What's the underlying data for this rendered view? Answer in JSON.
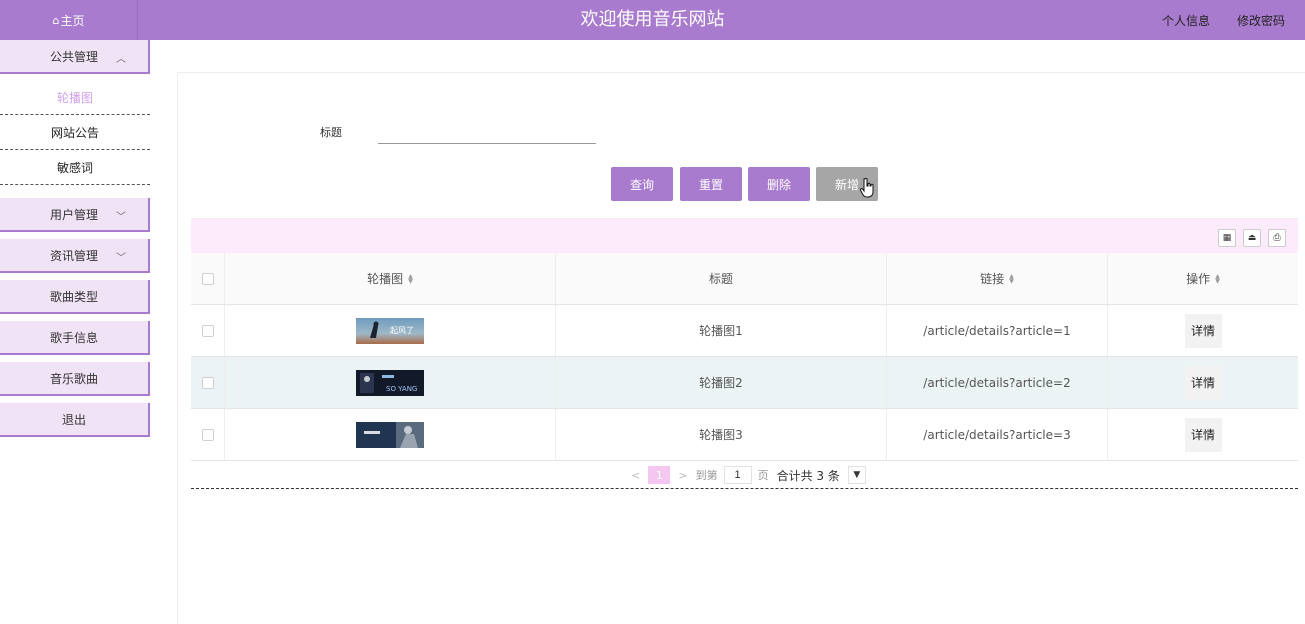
{
  "header": {
    "home_label": "主页",
    "title": "欢迎使用音乐网站",
    "links": [
      "个人信息",
      "修改密码"
    ]
  },
  "sidebar": {
    "public": "公共管理",
    "sub_items": [
      "轮播图",
      "网站公告",
      "敏感词"
    ],
    "user": "用户管理",
    "news": "资讯管理",
    "song_type": "歌曲类型",
    "singer": "歌手信息",
    "music": "音乐歌曲",
    "logout": "退出"
  },
  "search": {
    "label": "标题",
    "value": ""
  },
  "buttons": {
    "query": "查询",
    "reset": "重置",
    "delete": "删除",
    "add": "新增"
  },
  "table": {
    "columns": [
      "轮播图",
      "标题",
      "链接",
      "操作"
    ],
    "rows": [
      {
        "title": "轮播图1",
        "link": "/article/details?article=1",
        "action": "详情"
      },
      {
        "title": "轮播图2",
        "link": "/article/details?article=2",
        "action": "详情"
      },
      {
        "title": "轮播图3",
        "link": "/article/details?article=3",
        "action": "详情"
      }
    ],
    "thumb_text": [
      "起风了",
      "SO YANG"
    ]
  },
  "pager": {
    "current": "1",
    "goto": "到第",
    "page_input": "1",
    "page": "页",
    "total": "合计共 3 条"
  },
  "colors": {
    "primary": "#a97bce",
    "toolbar": "#fbebfb",
    "active_menu": "#d39ff0"
  }
}
